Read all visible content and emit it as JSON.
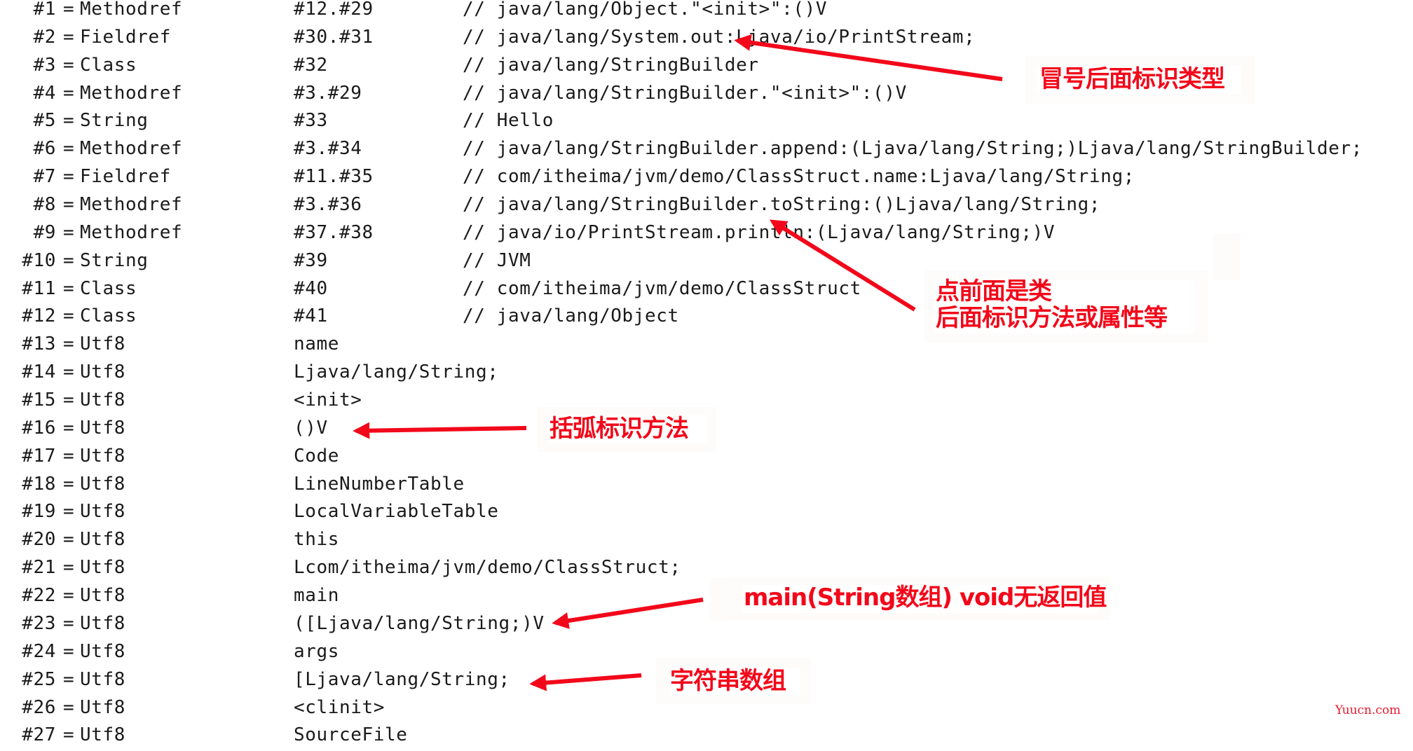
{
  "constant_pool": [
    {
      "index": "#1",
      "type": "Methodref",
      "ref": "#12.#29",
      "comment": "// java/lang/Object.\"<init>\":()V"
    },
    {
      "index": "#2",
      "type": "Fieldref",
      "ref": "#30.#31",
      "comment": "// java/lang/System.out:Ljava/io/PrintStream;"
    },
    {
      "index": "#3",
      "type": "Class",
      "ref": "#32",
      "comment": "// java/lang/StringBuilder"
    },
    {
      "index": "#4",
      "type": "Methodref",
      "ref": "#3.#29",
      "comment": "// java/lang/StringBuilder.\"<init>\":()V"
    },
    {
      "index": "#5",
      "type": "String",
      "ref": "#33",
      "comment": "// Hello"
    },
    {
      "index": "#6",
      "type": "Methodref",
      "ref": "#3.#34",
      "comment": "// java/lang/StringBuilder.append:(Ljava/lang/String;)Ljava/lang/StringBuilder;"
    },
    {
      "index": "#7",
      "type": "Fieldref",
      "ref": "#11.#35",
      "comment": "// com/itheima/jvm/demo/ClassStruct.name:Ljava/lang/String;"
    },
    {
      "index": "#8",
      "type": "Methodref",
      "ref": "#3.#36",
      "comment": "// java/lang/StringBuilder.toString:()Ljava/lang/String;"
    },
    {
      "index": "#9",
      "type": "Methodref",
      "ref": "#37.#38",
      "comment": "// java/io/PrintStream.println:(Ljava/lang/String;)V"
    },
    {
      "index": "#10",
      "type": "String",
      "ref": "#39",
      "comment": "// JVM"
    },
    {
      "index": "#11",
      "type": "Class",
      "ref": "#40",
      "comment": "// com/itheima/jvm/demo/ClassStruct"
    },
    {
      "index": "#12",
      "type": "Class",
      "ref": "#41",
      "comment": "// java/lang/Object"
    },
    {
      "index": "#13",
      "type": "Utf8",
      "ref": "name",
      "comment": ""
    },
    {
      "index": "#14",
      "type": "Utf8",
      "ref": "Ljava/lang/String;",
      "comment": ""
    },
    {
      "index": "#15",
      "type": "Utf8",
      "ref": "<init>",
      "comment": ""
    },
    {
      "index": "#16",
      "type": "Utf8",
      "ref": "()V",
      "comment": ""
    },
    {
      "index": "#17",
      "type": "Utf8",
      "ref": "Code",
      "comment": ""
    },
    {
      "index": "#18",
      "type": "Utf8",
      "ref": "LineNumberTable",
      "comment": ""
    },
    {
      "index": "#19",
      "type": "Utf8",
      "ref": "LocalVariableTable",
      "comment": ""
    },
    {
      "index": "#20",
      "type": "Utf8",
      "ref": "this",
      "comment": ""
    },
    {
      "index": "#21",
      "type": "Utf8",
      "ref": "Lcom/itheima/jvm/demo/ClassStruct;",
      "comment": ""
    },
    {
      "index": "#22",
      "type": "Utf8",
      "ref": "main",
      "comment": ""
    },
    {
      "index": "#23",
      "type": "Utf8",
      "ref": "([Ljava/lang/String;)V",
      "comment": ""
    },
    {
      "index": "#24",
      "type": "Utf8",
      "ref": "args",
      "comment": ""
    },
    {
      "index": "#25",
      "type": "Utf8",
      "ref": "[Ljava/lang/String;",
      "comment": ""
    },
    {
      "index": "#26",
      "type": "Utf8",
      "ref": "<clinit>",
      "comment": ""
    },
    {
      "index": "#27",
      "type": "Utf8",
      "ref": "SourceFile",
      "comment": ""
    }
  ],
  "equals_sign": "=",
  "annotations": {
    "colon_type": {
      "text": "冒号后面标识类型"
    },
    "dot_class": {
      "line1": "点前面是类",
      "line2": "后面标识方法或属性等"
    },
    "parens_method": {
      "text": "括弧标识方法"
    },
    "main_signature": {
      "text": "main(String数组) void无返回值"
    },
    "string_array": {
      "text": "字符串数组"
    }
  },
  "colors": {
    "annotation_red": "#f2081a",
    "text": "#1a1a1a",
    "watermark": "#e8182c"
  },
  "watermark": "Yuucn.com"
}
